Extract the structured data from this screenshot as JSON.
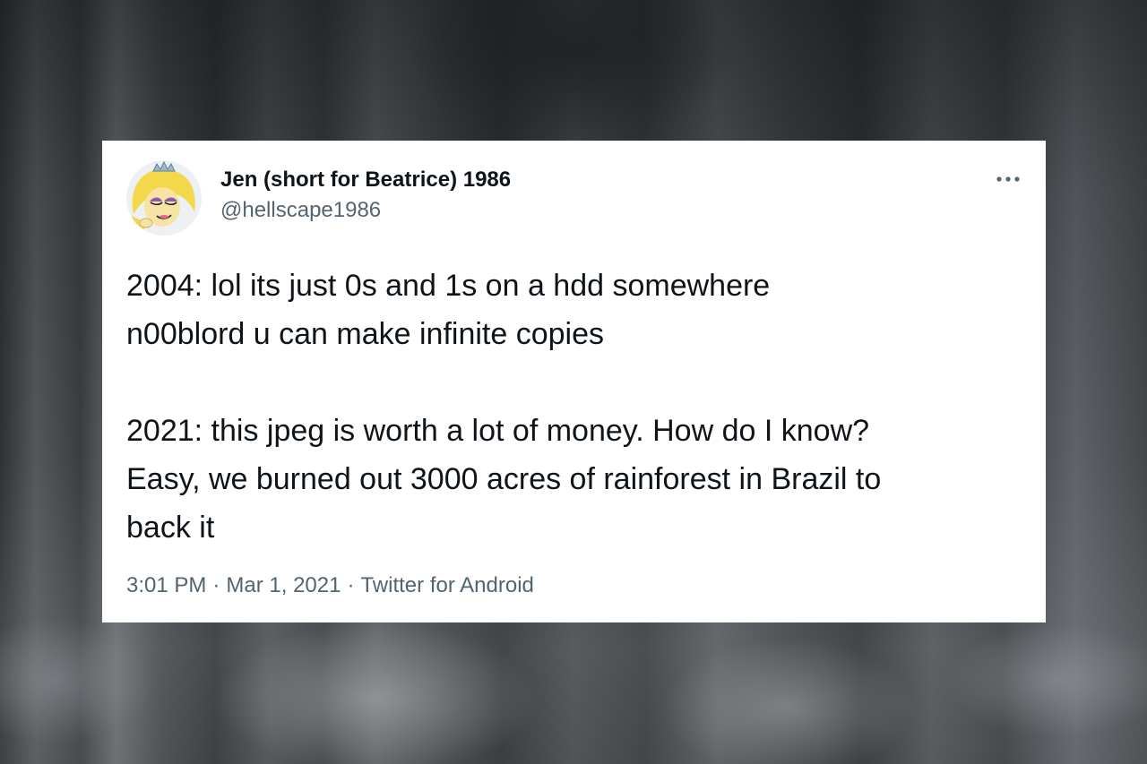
{
  "tweet": {
    "display_name": "Jen (short for Beatrice) 1986",
    "handle": "@hellscape1986",
    "avatar_icon": "cartoon-avatar-icon",
    "more_icon": "more-options-icon",
    "paragraph_1": [
      "2004: lol its just 0s and 1s on a hdd somewhere",
      "n00blord u can make infinite copies"
    ],
    "paragraph_2": [
      "2021: this jpeg is worth a lot of money. How do I know?",
      "Easy, we burned out 3000 acres of rainforest in Brazil to",
      "back it"
    ],
    "time": "3:01 PM",
    "separator": "·",
    "date": "Mar 1, 2021",
    "source": "Twitter for Android"
  },
  "colors": {
    "card_background": "#ffffff",
    "primary_text": "#0f1419",
    "secondary_text": "#536471"
  }
}
